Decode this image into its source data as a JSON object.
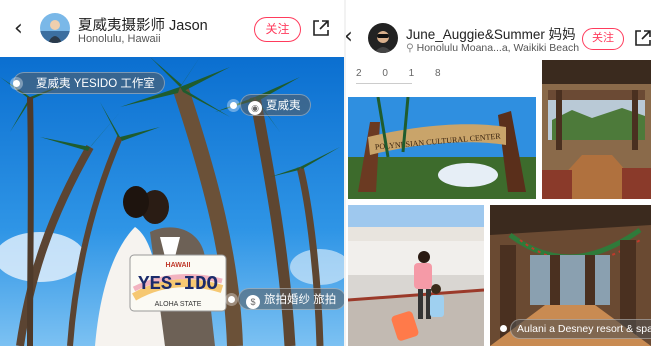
{
  "left_post": {
    "author_name": "夏威夷摄影师 Jason",
    "location": "Honolulu, Hawaii",
    "follow_label": "关注",
    "tags": {
      "studio": "夏威夷 YESIDO 工作室",
      "place": "夏威夷",
      "service": "旅拍婚纱 旅拍"
    },
    "photo": {
      "plate_top": "HAWAII",
      "plate_main": "YES-IDO",
      "plate_bottom": "ALOHA STATE"
    }
  },
  "right_post": {
    "author_name": "June_Auggie&Summer 妈妈",
    "location": "Honolulu Moana...a, Waikiki Beach",
    "follow_label": "关注",
    "date_label": "2 0 1 8",
    "arch_sign": "POLYNESIAN CULTURAL CENTER",
    "caption_tag": "Aulani a Desney resort & spa"
  },
  "colors": {
    "accent": "#ff3b5c",
    "sky": "#1e88e5"
  },
  "icons": {
    "back": "chevron-left-icon",
    "share": "share-icon",
    "location": "location-pin-icon"
  }
}
